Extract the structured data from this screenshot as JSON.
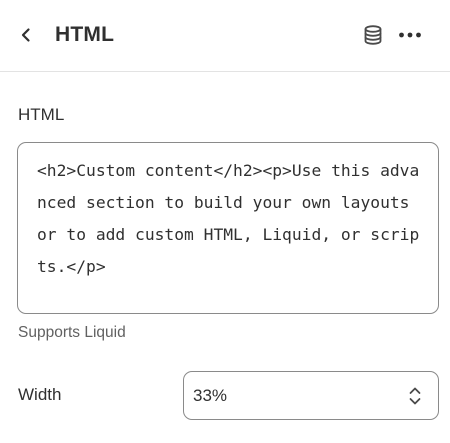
{
  "header": {
    "title": "HTML",
    "back_icon": "chevron-left-icon",
    "dynamic_source_icon": "database-icon",
    "more_icon": "horizontal-dots-icon"
  },
  "html_setting": {
    "label": "HTML",
    "value": "<h2>Custom content</h2><p>Use this advanced section to build your own layouts or to add custom HTML, Liquid, or scripts.</p>",
    "help_text": "Supports Liquid"
  },
  "width_setting": {
    "label": "Width",
    "selected": "33%",
    "chevron_icon": "select-chevron-icon"
  }
}
